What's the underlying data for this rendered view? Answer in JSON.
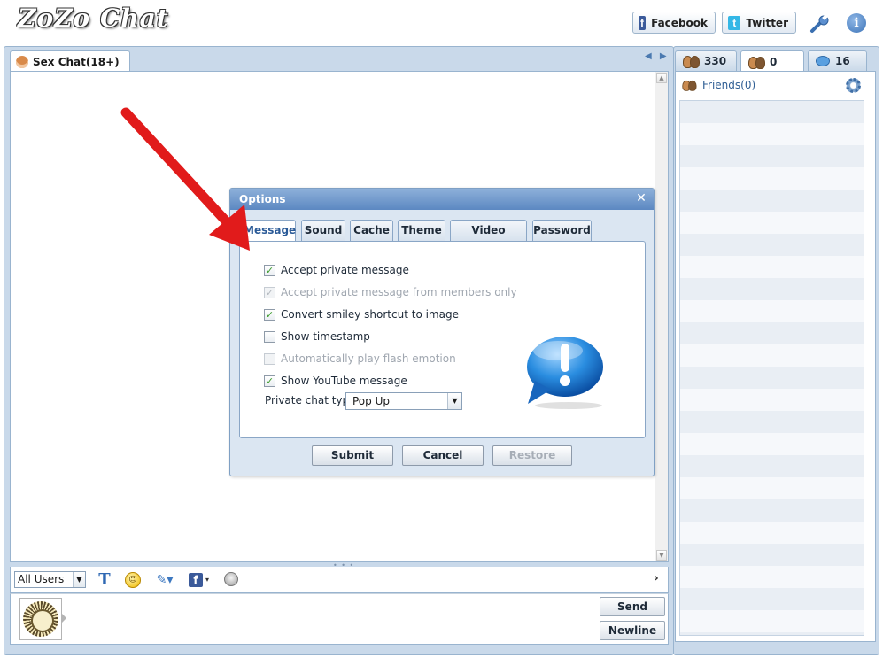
{
  "app": {
    "logo": "ZoZo Chat"
  },
  "header": {
    "facebook_label": "Facebook",
    "twitter_label": "Twitter",
    "facebook_glyph": "f",
    "twitter_glyph": "t",
    "info_glyph": "i"
  },
  "chat": {
    "room_tab": "Sex Chat(18+)",
    "nav": {
      "left": "◀",
      "right": "▶"
    },
    "scroll": {
      "up": "▲",
      "down": "▼"
    },
    "splitter": "• • •",
    "toolbar": {
      "recipient": "All Users",
      "recipient_arrow": "▼",
      "font_glyph": "T",
      "smiley_glyph": "☺",
      "brush_glyph": "✎▾",
      "fb_glyph": "f",
      "fb_dd": "▾",
      "expand": "›"
    },
    "send_label": "Send",
    "newline_label": "Newline"
  },
  "right": {
    "tabs": [
      {
        "label": "330",
        "icon": "users-icon"
      },
      {
        "label": "0",
        "icon": "friends-icon"
      },
      {
        "label": "16",
        "icon": "chat-bubble-icon"
      }
    ],
    "friends_label": "Friends(0)"
  },
  "dialog": {
    "title": "Options",
    "close": "✕",
    "tabs": [
      "Message",
      "Sound",
      "Cache",
      "Theme",
      "Video Layout",
      "Password"
    ],
    "options": [
      {
        "label": "Accept private message",
        "checked": true,
        "disabled": false
      },
      {
        "label": "Accept private message from members only",
        "checked": true,
        "disabled": true
      },
      {
        "label": "Convert smiley shortcut to image",
        "checked": true,
        "disabled": false
      },
      {
        "label": "Show timestamp",
        "checked": false,
        "disabled": false
      },
      {
        "label": "Automatically play flash emotion",
        "checked": false,
        "disabled": true
      },
      {
        "label": "Show YouTube message",
        "checked": true,
        "disabled": false
      }
    ],
    "private_chat_label": "Private chat type:",
    "private_chat_value": "Pop Up",
    "select_arrow": "▼",
    "check_mark": "✓",
    "submit": "Submit",
    "cancel": "Cancel",
    "restore": "Restore"
  },
  "colors": {
    "accent": "#5c88c2",
    "frame": "#c9d9ea",
    "arrow": "#e11b1b",
    "check": "#3a9a2a"
  }
}
